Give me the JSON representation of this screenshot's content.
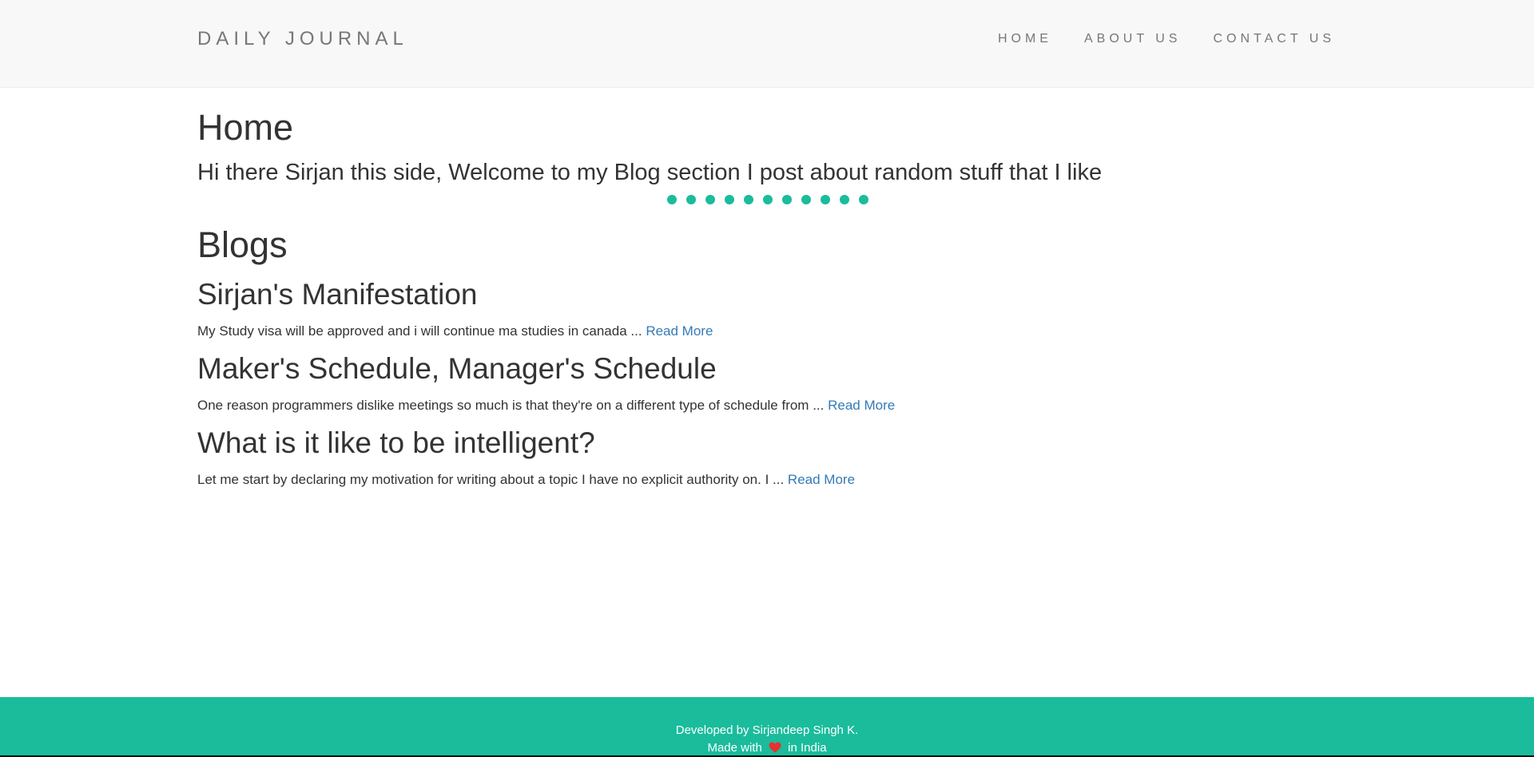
{
  "navbar": {
    "brand": "DAILY JOURNAL",
    "links": [
      {
        "label": "HOME"
      },
      {
        "label": "ABOUT US"
      },
      {
        "label": "CONTACT US"
      }
    ]
  },
  "main": {
    "title": "Home",
    "intro": "Hi there Sirjan this side, Welcome to my Blog section I post about random stuff that I like",
    "dots_count": 11,
    "accent_color": "#1abc9c",
    "blogs_heading": "Blogs",
    "read_more_label": "Read More",
    "link_color": "#337ab7",
    "posts": [
      {
        "title": "Sirjan's Manifestation",
        "excerpt": "My Study visa will be approved and i will continue ma studies in canada ..."
      },
      {
        "title": "Maker's Schedule, Manager's Schedule",
        "excerpt": "One reason programmers dislike meetings so much is that they're on a different type of schedule from ..."
      },
      {
        "title": "What is it like to be intelligent?",
        "excerpt": "Let me start by declaring my motivation for writing about a topic I have no explicit authority on. I ..."
      }
    ]
  },
  "footer": {
    "developer_text": "Developed by Sirjandeep Singh K.",
    "made_with_prefix": "Made with",
    "made_with_suffix": "in India",
    "heart_icon": "heart-icon",
    "heart_color": "#e8302d",
    "background": "#1abc9c"
  }
}
